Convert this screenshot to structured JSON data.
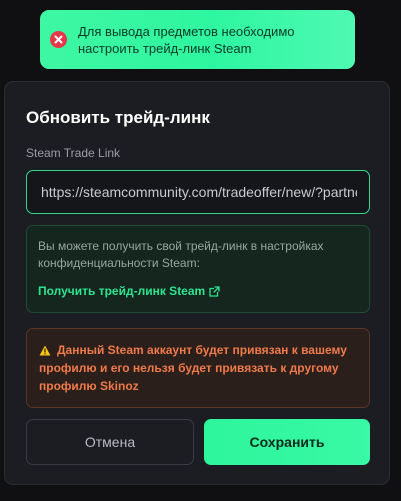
{
  "toast": {
    "message": "Для вывода предметов необходимо настроить трейд-линк Steam",
    "icon": "error-icon",
    "color": "#3ff7a2"
  },
  "modal": {
    "title": "Обновить трейд-линк",
    "field_label": "Steam Trade Link",
    "input_value": "https://steamcommunity.com/tradeoffer/new/?partner=",
    "info": {
      "text": "Вы можете получить свой трейд-линк в настройках конфиденциальности Steam:",
      "link_label": "Получить трейд-линк Steam"
    },
    "warning": {
      "text": "Данный Steam аккаунт будет привязан к вашему профилю и его нельзя будет привязать к другому профилю Skinoz"
    },
    "cancel_label": "Отмена",
    "save_label": "Сохранить",
    "accent_color": "#2ee58f",
    "warning_color": "#f07a4a"
  }
}
